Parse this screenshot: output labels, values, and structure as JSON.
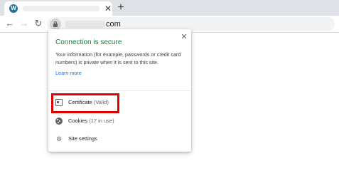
{
  "tab": {
    "favicon_letter": "W",
    "close_glyph": "✕",
    "new_tab_glyph": "+"
  },
  "toolbar": {
    "back_glyph": "←",
    "forward_glyph": "→",
    "reload_glyph": "↻",
    "url_visible": "com"
  },
  "popup": {
    "close_glyph": "✕",
    "title": "Connection is secure",
    "description": "Your information (for example, passwords or credit card numbers) is private when it is sent to this site.",
    "learn_more": "Learn more",
    "items": [
      {
        "icon": "certificate-icon",
        "label": "Certificate",
        "status": "(Valid)"
      },
      {
        "icon": "cookie-icon",
        "label": "Cookies",
        "status": "(17 in use)"
      },
      {
        "icon": "gear-icon",
        "label": "Site settings",
        "status": ""
      }
    ]
  },
  "colors": {
    "secure_green": "#188038",
    "link_blue": "#1a73e8",
    "highlight_red": "#e00000"
  }
}
